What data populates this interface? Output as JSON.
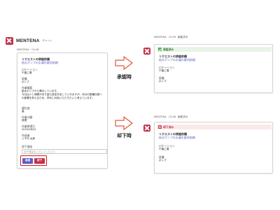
{
  "app": {
    "name": "MENTENA",
    "tab": "チャット"
  },
  "left_message": {
    "sender": "MENTENA",
    "time": "13:48",
    "title": "リクエストの承認依頼",
    "link_text": "給水ポンプの水漏れ解消依頼",
    "fields": [
      {
        "label": "ロケーション",
        "value": "千葉工場"
      },
      {
        "label": "設備",
        "value": "ポンプ"
      },
      {
        "label": "作業概要",
        "lines": [
          "給水ポンプから漏水しています。",
          "今日は少し時間があり量も設定を戻していきますが、本月の整備日程への影響を抑えるため、早めに対処いただきたいと考えています。"
        ]
      },
      {
        "label": "優先度",
        "value": "高"
      },
      {
        "label": "作業分類",
        "value": "修理"
      },
      {
        "label": "作業希望日",
        "value": "2025/08/31"
      },
      {
        "label": "作成者",
        "value": "八千代 太郎"
      }
    ],
    "reason_label": "却下理由",
    "reason_placeholder": "却下理由を入力してください",
    "approve_button": "承認",
    "reject_button": "却下"
  },
  "approved_message": {
    "sender": "MENTENA",
    "time": "13:59",
    "edited": "編集済み",
    "status": "承認済み",
    "title": "リクエストの承認依頼",
    "link_text": "給水ポンプの水漏れ解消依頼",
    "fields": [
      {
        "label": "ロケーション",
        "value": "千葉工場"
      },
      {
        "label": "設備",
        "value": "ポンプ"
      }
    ]
  },
  "rejected_message": {
    "sender": "MENTENA",
    "time": "13:48",
    "edited": "編集済み",
    "status": "却下済み",
    "title": "リクエストの承認依頼",
    "link_text": "給水ポンプの水漏れ解消依頼",
    "fields": [
      {
        "label": "ロケーション",
        "value": "千葉工場"
      },
      {
        "label": "設備",
        "value": "ポンプ"
      }
    ]
  },
  "arrows": {
    "approved_label": "承認時",
    "rejected_label": "却下時"
  },
  "colors": {
    "accent": "#5b5fc7",
    "reject": "#c4314b",
    "approved_green": "#4caf50",
    "highlight_red": "#d11a1a",
    "arrow_red": "#e05a3a"
  }
}
